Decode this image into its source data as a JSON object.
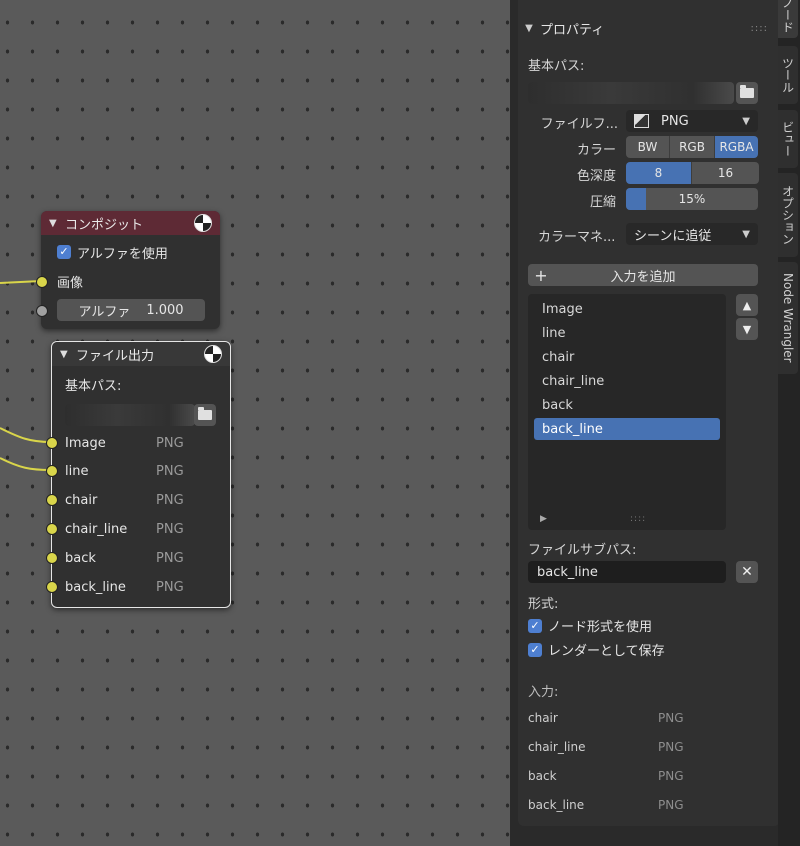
{
  "composite_node": {
    "title": "コンポジット",
    "use_alpha_label": "アルファを使用",
    "image_label": "画像",
    "alpha_label": "アルファ",
    "alpha_value": "1.000"
  },
  "file_output_node": {
    "title": "ファイル出力",
    "base_path_label": "基本パス:",
    "inputs": [
      {
        "name": "Image",
        "format": "PNG"
      },
      {
        "name": "line",
        "format": "PNG"
      },
      {
        "name": "chair",
        "format": "PNG"
      },
      {
        "name": "chair_line",
        "format": "PNG"
      },
      {
        "name": "back",
        "format": "PNG"
      },
      {
        "name": "back_line",
        "format": "PNG"
      }
    ]
  },
  "panel": {
    "section_title": "プロパティ",
    "base_path_label": "基本パス:",
    "file_format_label": "ファイルフ...",
    "file_format_value": "PNG",
    "color_label": "カラー",
    "color_options": [
      "BW",
      "RGB",
      "RGBA"
    ],
    "color_selected": "RGBA",
    "depth_label": "色深度",
    "depth_options": [
      "8",
      "16"
    ],
    "depth_selected": "8",
    "compression_label": "圧縮",
    "compression_value": "15%",
    "compression_fraction": 0.15,
    "color_management_label": "カラーマネ...",
    "color_management_value": "シーンに追従",
    "add_input_label": "入力を追加",
    "list_items": [
      "Image",
      "line",
      "chair",
      "chair_line",
      "back",
      "back_line"
    ],
    "list_selected": "back_line",
    "file_subpath_label": "ファイルサブパス:",
    "file_subpath_value": "back_line",
    "format_label": "形式:",
    "use_node_format_label": "ノード形式を使用",
    "save_as_render_label": "レンダーとして保存",
    "inputs_label": "入力:",
    "inputs": [
      {
        "name": "chair",
        "format": "PNG"
      },
      {
        "name": "chair_line",
        "format": "PNG"
      },
      {
        "name": "back",
        "format": "PNG"
      },
      {
        "name": "back_line",
        "format": "PNG"
      }
    ]
  },
  "tabs": [
    "ノード",
    "ツール",
    "ビュー",
    "オプション",
    "Node Wrangler"
  ],
  "colors": {
    "accent": "#4772b3",
    "socket": "#d9d54a",
    "composite_header": "#5e2a35"
  }
}
